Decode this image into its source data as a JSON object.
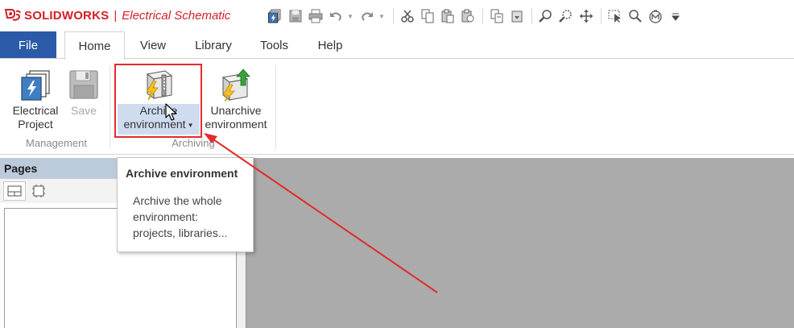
{
  "title_bar": {
    "brand": "SOLIDWORKS",
    "separator": "|",
    "app_name": "Electrical Schematic"
  },
  "quick_access": {
    "icons": [
      "new-project-icon",
      "save-icon",
      "print-icon",
      "undo-icon",
      "redo-icon",
      "cut-icon",
      "copy-icon",
      "paste-icon",
      "paste-special-icon",
      "copy-format-icon",
      "paste-format-icon",
      "zoom-icon",
      "zoom-window-icon",
      "pan-icon",
      "select-icon",
      "search-icon",
      "macro-icon",
      "customize-icon"
    ]
  },
  "tabs": [
    {
      "label": "File"
    },
    {
      "label": "Home"
    },
    {
      "label": "View"
    },
    {
      "label": "Library"
    },
    {
      "label": "Tools"
    },
    {
      "label": "Help"
    }
  ],
  "active_tab": "Home",
  "ribbon": {
    "management": {
      "label": "Management",
      "electrical_project": {
        "line1": "Electrical",
        "line2": "Project"
      },
      "save": {
        "line1": "Save"
      }
    },
    "archiving": {
      "label": "Archiving",
      "archive": {
        "line1": "Archive",
        "line2": "environment"
      },
      "unarchive": {
        "line1": "Unarchive",
        "line2": "environment"
      }
    }
  },
  "pages_pane": {
    "title": "Pages"
  },
  "tooltip": {
    "title": "Archive environment",
    "line1": "Archive the whole",
    "line2": "environment:",
    "line3": "projects, libraries..."
  },
  "colors": {
    "brand_red": "#d32027",
    "file_tab_blue": "#2b5aa8",
    "annotation_red": "#e32b2b",
    "workspace_gray": "#ababab",
    "pane_header": "#bccbdc"
  }
}
